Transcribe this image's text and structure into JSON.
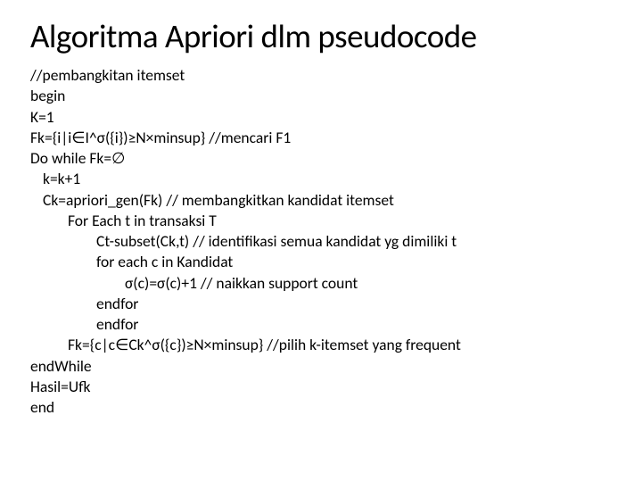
{
  "title": "Algoritma Apriori dlm pseudocode",
  "lines": [
    {
      "cls": "",
      "text": "//pembangkitan itemset"
    },
    {
      "cls": "",
      "text": "begin"
    },
    {
      "cls": "",
      "text": "K=1"
    },
    {
      "cls": "",
      "text": "Fk={i|i∈I^σ({i})≥N×minsup} //mencari F1"
    },
    {
      "cls": "",
      "text": "Do while Fk=∅"
    },
    {
      "cls": "i1",
      "text": "k=k+1"
    },
    {
      "cls": "i1",
      "text": "Ck=apriori_gen(Fk) // membangkitkan kandidat itemset"
    },
    {
      "cls": "i2",
      "text": "For Each t in transaksi T"
    },
    {
      "cls": "i3",
      "text": "Ct-subset(Ck,t) // identifikasi semua kandidat yg dimiliki t"
    },
    {
      "cls": "i3",
      "text": "for each c in Kandidat"
    },
    {
      "cls": "i4",
      "text": "σ(c)=σ(c)+1 // naikkan support count"
    },
    {
      "cls": "i3",
      "text": "endfor"
    },
    {
      "cls": "i5",
      "text": "endfor"
    },
    {
      "cls": "i6",
      "text": "Fk={c|c∈Ck^σ({c})≥N×minsup} //pilih k-itemset yang frequent"
    },
    {
      "cls": "",
      "text": "endWhile"
    },
    {
      "cls": "",
      "text": "Hasil=Ufk"
    },
    {
      "cls": "",
      "text": "end"
    }
  ]
}
